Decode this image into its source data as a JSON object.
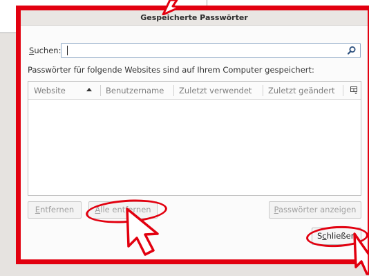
{
  "dialog": {
    "title": "Gespeicherte Passwörter",
    "search": {
      "label_accesskey": "S",
      "label_rest": "uchen:",
      "value": ""
    },
    "info_text": "Passwörter für folgende Websites sind auf Ihrem Computer gespeichert:",
    "table": {
      "columns": [
        {
          "label": "Website",
          "sorted": "ascending"
        },
        {
          "label": "Benutzername"
        },
        {
          "label": "Zuletzt verwendet"
        },
        {
          "label": "Zuletzt geändert"
        }
      ],
      "rows": []
    },
    "buttons": {
      "remove": {
        "accesskey": "E",
        "rest": "ntfernen",
        "enabled": false
      },
      "remove_all": {
        "accesskey": "A",
        "rest": "lle entfernen",
        "enabled": false
      },
      "show_passwords": {
        "accesskey": "P",
        "rest": "asswörter anzeigen",
        "enabled": false
      },
      "close": {
        "pre": "S",
        "accesskey": "c",
        "rest": "hließen",
        "enabled": true
      }
    }
  },
  "colors": {
    "highlight": "#e2000f",
    "titlebar": "#e9e6e3"
  },
  "icons": {
    "search": "search-icon",
    "column_picker": "column-picker-icon",
    "cursor": "mouse-pointer-icon"
  }
}
